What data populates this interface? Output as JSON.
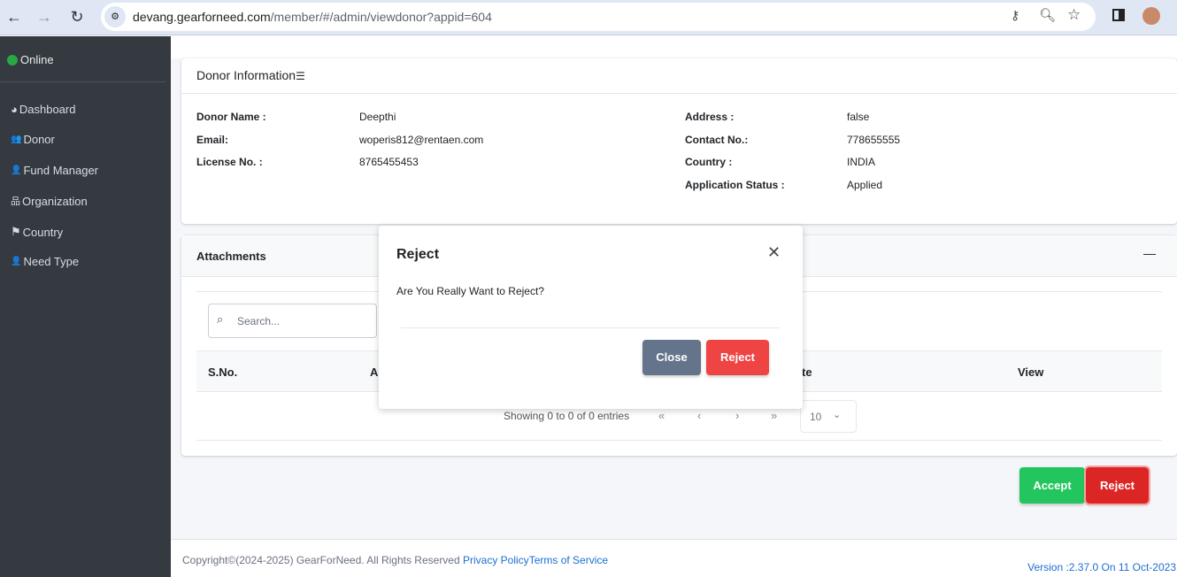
{
  "browser": {
    "url_host": "devang.gearforneed.com",
    "url_path": "/member/#/admin/viewdonor?appid=604"
  },
  "sidebar": {
    "status": "Online",
    "status_color": "#28a745",
    "items": [
      {
        "label": "Dashboard",
        "icon": "pie-chart-icon",
        "glyph": "◕"
      },
      {
        "label": "Donor",
        "icon": "users-icon",
        "glyph": "👥"
      },
      {
        "label": "Fund Manager",
        "icon": "user-tie-icon",
        "glyph": "👤"
      },
      {
        "label": "Organization",
        "icon": "sitemap-icon",
        "glyph": "品"
      },
      {
        "label": "Country",
        "icon": "flag-icon",
        "glyph": "⚑"
      },
      {
        "label": "Need Type",
        "icon": "user-hand-icon",
        "glyph": "👤"
      }
    ]
  },
  "donor_info": {
    "title": "Donor Information",
    "left": [
      {
        "label": "Donor Name :",
        "value": "Deepthi"
      },
      {
        "label": "Email:",
        "value": "woperis812@rentaen.com"
      },
      {
        "label": "License No. :",
        "value": "8765455453"
      }
    ],
    "right": [
      {
        "label": "Address :",
        "value": "false"
      },
      {
        "label": "Contact No.:",
        "value": "778655555"
      },
      {
        "label": "Country :",
        "value": "INDIA"
      },
      {
        "label": "Application Status :",
        "value": "Applied"
      }
    ]
  },
  "attachments": {
    "title": "Attachments",
    "collapse": "—",
    "search_placeholder": "Search...",
    "columns": [
      "S.No.",
      "A",
      "te",
      "View"
    ],
    "info": "Showing 0 to 0 of 0 entries",
    "pager": [
      "«",
      "‹",
      "›",
      "»"
    ],
    "page_size": "10"
  },
  "actions": {
    "accept": "Accept",
    "reject": "Reject",
    "accept_color": "#22c55e",
    "reject_color": "#dc2626"
  },
  "modal": {
    "title": "Reject",
    "message": "Are You Really Want to Reject?",
    "close": "Close",
    "reject": "Reject",
    "close_color": "#64748b",
    "reject_color": "#ef4444"
  },
  "footer": {
    "copyright": "Copyright©(2024-2025) GearForNeed. All Rights Reserved ",
    "privacy": "Privacy Policy",
    "terms": "Terms of Service",
    "version": "Version :2.37.0 On 11 Oct-2023"
  }
}
